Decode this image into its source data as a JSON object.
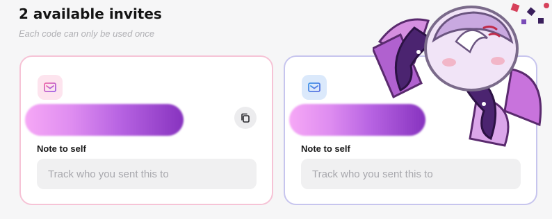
{
  "header": {
    "title": "2 available invites",
    "subtitle": "Each code can only be used once"
  },
  "invites": [
    {
      "theme": "pink",
      "icon": "envelope-icon",
      "accent": "#e86fb4",
      "note_label": "Note to self",
      "note_placeholder": "Track who you sent this to",
      "note_value": "",
      "copy_icon": "copy-icon"
    },
    {
      "theme": "blue",
      "icon": "envelope-icon",
      "accent": "#4a8ee8",
      "note_label": "Note to self",
      "note_placeholder": "Track who you sent this to",
      "note_value": ""
    }
  ],
  "colors": {
    "background": "#f6f6f7",
    "pink_border": "#f6c3d6",
    "blue_border": "#c7c5ee",
    "redaction_start": "#f6a8f6",
    "redaction_end": "#8733bf"
  }
}
